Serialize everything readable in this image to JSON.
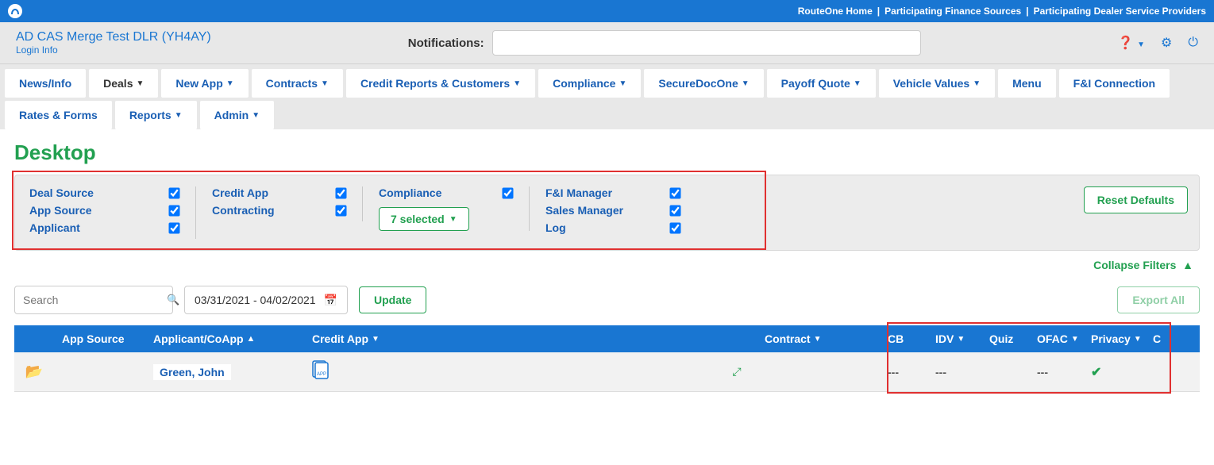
{
  "topbar": {
    "links": [
      "RouteOne Home",
      "Participating Finance Sources",
      "Participating Dealer Service Providers"
    ]
  },
  "header": {
    "dealer_name": "AD CAS Merge Test DLR (YH4AY)",
    "login_info": "Login Info",
    "notifications_label": "Notifications:"
  },
  "nav": {
    "items": [
      {
        "label": "News/Info",
        "dropdown": false
      },
      {
        "label": "Deals",
        "dropdown": true,
        "active": true
      },
      {
        "label": "New App",
        "dropdown": true
      },
      {
        "label": "Contracts",
        "dropdown": true
      },
      {
        "label": "Credit Reports & Customers",
        "dropdown": true
      },
      {
        "label": "Compliance",
        "dropdown": true
      },
      {
        "label": "SecureDocOne",
        "dropdown": true
      },
      {
        "label": "Payoff Quote",
        "dropdown": true
      },
      {
        "label": "Vehicle Values",
        "dropdown": true
      },
      {
        "label": "Menu",
        "dropdown": false
      },
      {
        "label": "F&I Connection",
        "dropdown": false
      },
      {
        "label": "Rates & Forms",
        "dropdown": false
      },
      {
        "label": "Reports",
        "dropdown": true
      },
      {
        "label": "Admin",
        "dropdown": true
      }
    ]
  },
  "page_title": "Desktop",
  "filters": {
    "group1": [
      {
        "label": "Deal Source",
        "checked": true
      },
      {
        "label": "App Source",
        "checked": true
      },
      {
        "label": "Applicant",
        "checked": true
      }
    ],
    "group2": [
      {
        "label": "Credit App",
        "checked": true
      },
      {
        "label": "Contracting",
        "checked": true
      }
    ],
    "group3_label": "Compliance",
    "group3_checked": true,
    "group3_select": "7 selected",
    "group4": [
      {
        "label": "F&I Manager",
        "checked": true
      },
      {
        "label": "Sales Manager",
        "checked": true
      },
      {
        "label": "Log",
        "checked": true
      }
    ],
    "reset": "Reset Defaults",
    "collapse": "Collapse Filters"
  },
  "actions": {
    "search_placeholder": "Search",
    "date_range": "03/31/2021 - 04/02/2021",
    "update": "Update",
    "export": "Export All"
  },
  "table": {
    "headers": {
      "app_source": "App Source",
      "applicant": "Applicant/CoApp",
      "credit_app": "Credit App",
      "contract": "Contract",
      "cb": "CB",
      "idv": "IDV",
      "quiz": "Quiz",
      "ofac": "OFAC",
      "privacy": "Privacy",
      "c": "C"
    },
    "row": {
      "applicant": "Green, John",
      "cb": "---",
      "idv": "---",
      "quiz": "",
      "ofac": "---"
    }
  }
}
